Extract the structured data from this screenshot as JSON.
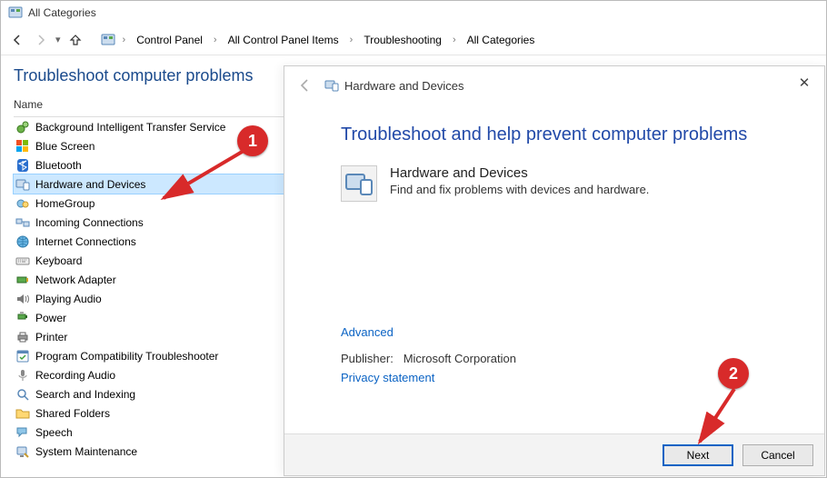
{
  "window": {
    "title": "All Categories"
  },
  "breadcrumb": {
    "items": [
      "Control Panel",
      "All Control Panel Items",
      "Troubleshooting",
      "All Categories"
    ]
  },
  "page_heading": "Troubleshoot computer problems",
  "column_header": "Name",
  "list": {
    "selected_index": 3,
    "items": [
      {
        "label": "Background Intelligent Transfer Service",
        "icon": "gears"
      },
      {
        "label": "Blue Screen",
        "icon": "flag"
      },
      {
        "label": "Bluetooth",
        "icon": "bluetooth"
      },
      {
        "label": "Hardware and Devices",
        "icon": "device"
      },
      {
        "label": "HomeGroup",
        "icon": "homegroup"
      },
      {
        "label": "Incoming Connections",
        "icon": "netin"
      },
      {
        "label": "Internet Connections",
        "icon": "globe"
      },
      {
        "label": "Keyboard",
        "icon": "keyboard"
      },
      {
        "label": "Network Adapter",
        "icon": "adapter"
      },
      {
        "label": "Playing Audio",
        "icon": "speaker"
      },
      {
        "label": "Power",
        "icon": "power"
      },
      {
        "label": "Printer",
        "icon": "printer"
      },
      {
        "label": "Program Compatibility Troubleshooter",
        "icon": "compat"
      },
      {
        "label": "Recording Audio",
        "icon": "mic"
      },
      {
        "label": "Search and Indexing",
        "icon": "search"
      },
      {
        "label": "Shared Folders",
        "icon": "folder"
      },
      {
        "label": "Speech",
        "icon": "speech"
      },
      {
        "label": "System Maintenance",
        "icon": "maint"
      }
    ]
  },
  "wizard": {
    "title": "Hardware and Devices",
    "heading": "Troubleshoot and help prevent computer problems",
    "item_title": "Hardware and Devices",
    "item_desc": "Find and fix problems with devices and hardware.",
    "advanced": "Advanced",
    "publisher_label": "Publisher:",
    "publisher_value": "Microsoft Corporation",
    "privacy": "Privacy statement",
    "buttons": {
      "next": "Next",
      "cancel": "Cancel"
    }
  },
  "annotations": {
    "step1": "1",
    "step2": "2"
  }
}
